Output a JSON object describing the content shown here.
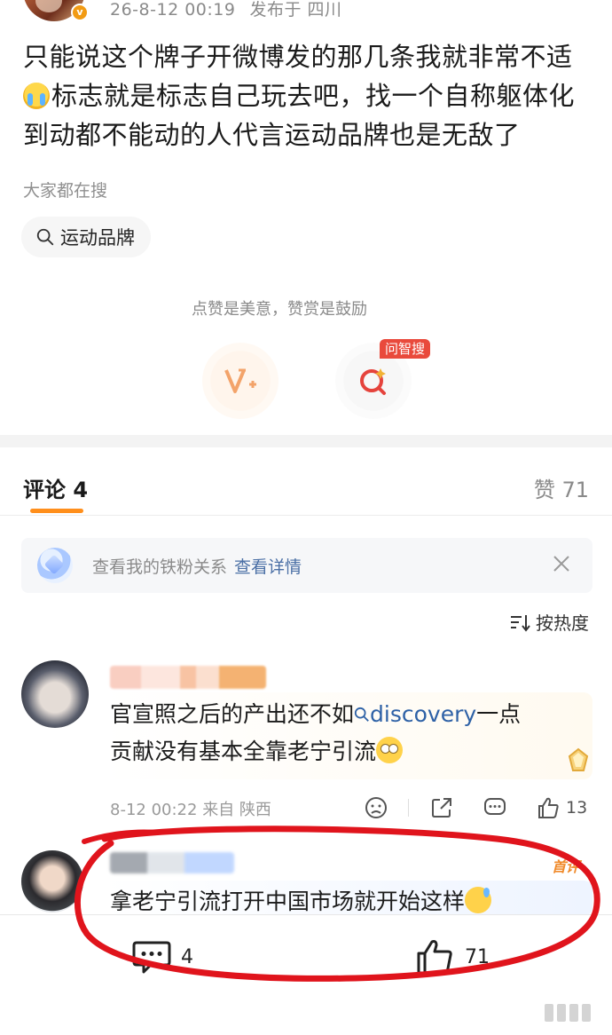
{
  "post": {
    "date": "26-8-12 00:19",
    "location": "发布于 四川",
    "text_line1": "只能说这个牌子开微博发的那几条我就非常不适",
    "text_line2": "标志就是标志自己玩去吧，找一个自称躯体化",
    "text_line3": "到动都不能动的人代言运动品牌也是无敌了"
  },
  "search": {
    "heading": "大家都在搜",
    "chip_label": "运动品牌"
  },
  "reward": {
    "prompt": "点赞是美意，赞赏是鼓励",
    "ai_badge": "问智搜"
  },
  "comments_header": {
    "tab_label": "评论 4",
    "likes_label": "赞 71"
  },
  "fan_banner": {
    "text": "查看我的铁粉关系",
    "link": "查看详情"
  },
  "sort": {
    "label": "按热度"
  },
  "comment1": {
    "text_part1": "官宣照之后的产出还不如",
    "search_term": "discovery",
    "text_part2": "一点",
    "text_line2": "贡献没有基本全靠老宁引流",
    "time": "8-12 00:22",
    "location": "来自 陕西",
    "like_count": "13"
  },
  "comment2": {
    "first_badge": "首评",
    "text": "拿老宁引流打开中国市场就开始这样"
  },
  "bottom_bar": {
    "comment_count": "4",
    "like_count": "71"
  },
  "colors": {
    "accent_orange": "#ff8f1c",
    "link_blue": "#2e61a6",
    "annotation_red": "#e0141c"
  }
}
